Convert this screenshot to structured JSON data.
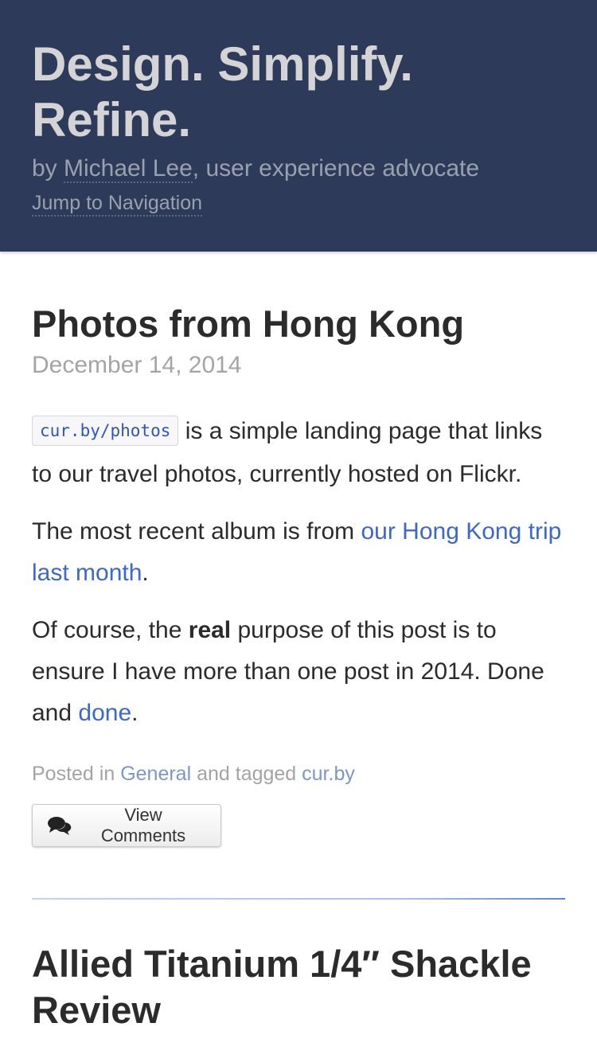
{
  "header": {
    "site_title": "Design. Simplify. Refine.",
    "tagline_prefix": "by ",
    "author_name": "Michael Lee",
    "tagline_suffix": ", user experience advocate",
    "jump_link": "Jump to Navigation"
  },
  "post": {
    "title": "Photos from Hong Kong",
    "date": "December 14, 2014",
    "p1_code": "cur.by/photos",
    "p1_text": " is a simple landing page that links to our travel photos, currently hosted on Flickr.",
    "p2_prefix": "The most recent album is from ",
    "p2_link": "our Hong Kong trip last month",
    "p2_suffix": ".",
    "p3_prefix": "Of course, the ",
    "p3_bold": "real",
    "p3_middle": " purpose of this post is to ensure I have more than one post in 2014. Done and ",
    "p3_link": "done",
    "p3_suffix": ".",
    "meta_posted_in": "Posted in ",
    "meta_category": "General",
    "meta_tagged": " and tagged ",
    "meta_tag": "cur.by",
    "comments_button": "View Comments"
  },
  "next_post": {
    "title": "Allied Titanium 1/4″ Shackle Review"
  },
  "colors": {
    "header_bg": "#2d3a59",
    "link": "#3d67c8",
    "meta_link": "#7c97c9"
  },
  "icons": {
    "comments": "comments-icon"
  }
}
